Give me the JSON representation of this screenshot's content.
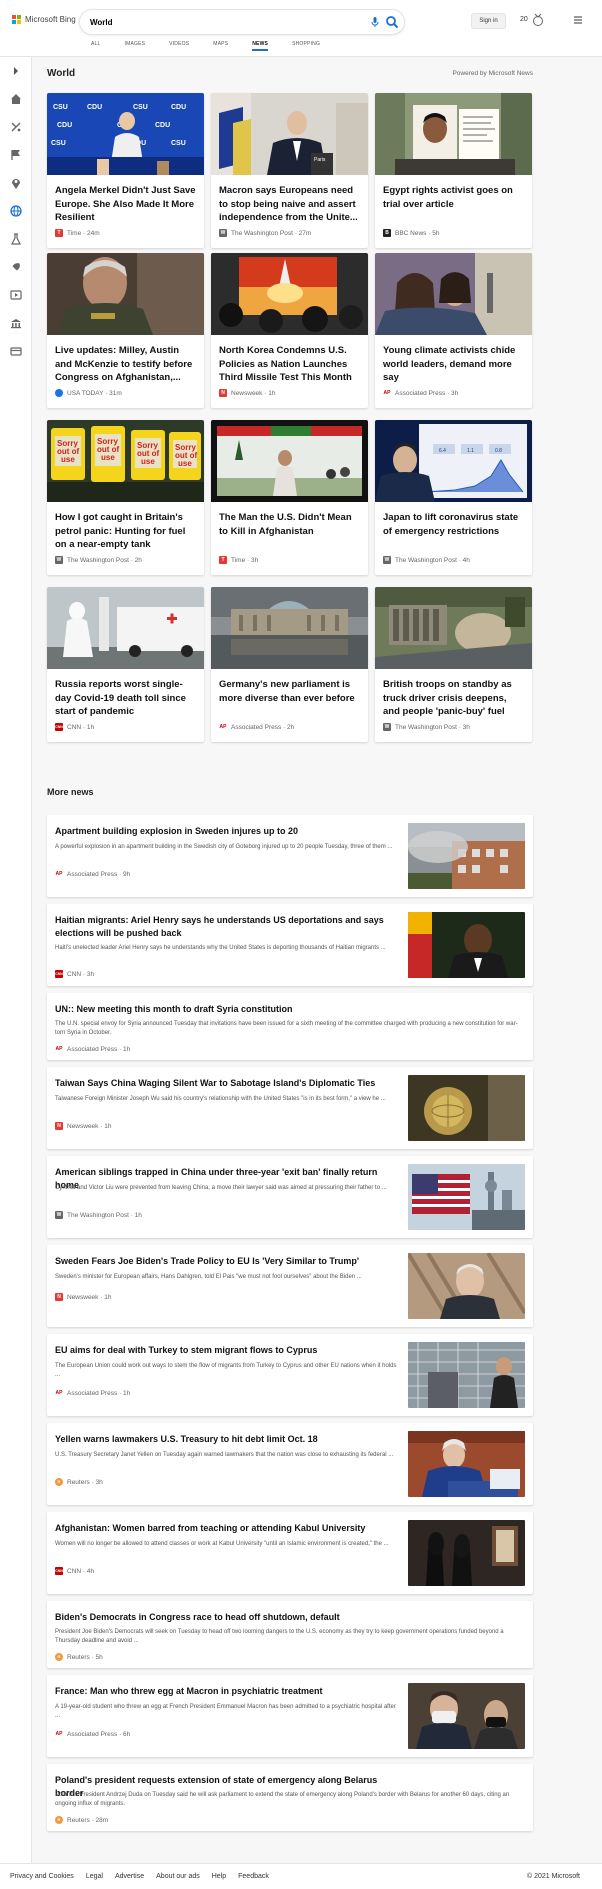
{
  "header": {
    "brand": "Microsoft Bing",
    "search_value": "World",
    "sign_in": "Sign in",
    "points": "20",
    "tabs": [
      {
        "label": "ALL"
      },
      {
        "label": "IMAGES"
      },
      {
        "label": "VIDEOS"
      },
      {
        "label": "MAPS"
      },
      {
        "label": "NEWS"
      },
      {
        "label": "SHOPPING"
      }
    ]
  },
  "rail": {
    "icons": [
      "expand-icon",
      "home-icon",
      "sports-icon",
      "flag-icon",
      "location-icon",
      "globe-icon",
      "science-icon",
      "rocket-icon",
      "entertainment-icon",
      "business-icon",
      "money-icon"
    ]
  },
  "section": {
    "title": "World",
    "powered_by": "Powered by Microsoft News"
  },
  "cards": [
    {
      "title": "Angela Merkel Didn't Just Save Europe. She Also Made It More Resilient",
      "source": "Time · 24m",
      "badge": "T",
      "badge_color": "#e53935"
    },
    {
      "title": "Macron says Europeans need to stop being naive and assert independence from the Unite...",
      "source": "The Washington Post · 27m",
      "badge": "W",
      "badge_color": "#666666"
    },
    {
      "title": "Egypt rights activist goes on trial over article",
      "source": "BBC News · 5h",
      "badge": "B",
      "badge_color": "#222222"
    },
    {
      "title": "Live updates: Milley, Austin and McKenzie to testify before Congress on Afghanistan,...",
      "source": "USA TODAY · 31m",
      "badge": "",
      "badge_color": "#1a73e8"
    },
    {
      "title": "North Korea Condemns U.S. Policies as Nation Launches Third Missile Test This Month",
      "source": "Newsweek · 1h",
      "badge": "N",
      "badge_color": "#e53935"
    },
    {
      "title": "Young climate activists chide world leaders, demand more say",
      "source": "Associated Press · 3h",
      "badge": "AP",
      "badge_color": "#ffffff"
    },
    {
      "title": "How I got caught in Britain's petrol panic: Hunting for fuel on a near-empty tank",
      "source": "The Washington Post · 2h",
      "badge": "W",
      "badge_color": "#666666"
    },
    {
      "title": "The Man the U.S. Didn't Mean to Kill in Afghanistan",
      "source": "Time · 3h",
      "badge": "T",
      "badge_color": "#e53935"
    },
    {
      "title": "Japan to lift coronavirus state of emergency restrictions",
      "source": "The Washington Post · 4h",
      "badge": "W",
      "badge_color": "#666666"
    },
    {
      "title": "Russia reports worst single-day Covid-19 death toll since start of pandemic",
      "source": "CNN · 1h",
      "badge": "CNN",
      "badge_color": "#cc0000"
    },
    {
      "title": "Germany's new parliament is more diverse than ever before",
      "source": "Associated Press · 2h",
      "badge": "AP",
      "badge_color": "#ffffff"
    },
    {
      "title": "British troops on standby as truck driver crisis deepens, and people 'panic-buy' fuel",
      "source": "The Washington Post · 3h",
      "badge": "W",
      "badge_color": "#666666"
    }
  ],
  "more_news": {
    "title": "More news",
    "items": [
      {
        "title": "Apartment building explosion in Sweden injures up to 20",
        "desc": "A powerful explosion in an apartment building in the Swedish city of Goteborg injured up to 20 people Tuesday, three of them ...",
        "source": "Associated Press · 9h",
        "badge": "AP"
      },
      {
        "title": "Haitian migrants: Ariel Henry says he understands US deportations and says elections will be pushed back",
        "desc": "Haiti's unelected leader Ariel Henry says he understands why the United States is deporting thousands of Haitian migrants ...",
        "source": "CNN · 3h",
        "badge": "CNN"
      },
      {
        "title": "UN:: New meeting this month to draft Syria constitution",
        "desc": "The U.N. special envoy for Syria announced Tuesday that invitations have been issued for a sixth meeting of the committee charged with producing a new constitution for war-torn Syria in October.",
        "source": "Associated Press · 1h",
        "badge": "AP"
      },
      {
        "title": "Taiwan Says China Waging Silent War to Sabotage Island's Diplomatic Ties",
        "desc": "Taiwanese Foreign Minister Joseph Wu said his country's relationship with the United States \"is in its best form,\" a view he ...",
        "source": "Newsweek · 1h",
        "badge": "N"
      },
      {
        "title": "American siblings trapped in China under three-year 'exit ban' finally return home",
        "desc": "Cynthia and Victor Liu were prevented from leaving China, a move their lawyer said was aimed at pressuring their father to ...",
        "source": "The Washington Post · 1h",
        "badge": "W"
      },
      {
        "title": "Sweden Fears Joe Biden's Trade Policy to EU Is 'Very Similar to Trump'",
        "desc": "Sweden's minister for European affairs, Hans Dahlgren, told El Pais \"we must not fool ourselves\" about the Biden ...",
        "source": "Newsweek · 1h",
        "badge": "N"
      },
      {
        "title": "EU aims for deal with Turkey to stem migrant flows to Cyprus",
        "desc": "The European Union could work out ways to stem the flow of migrants from Turkey to Cyprus and other EU nations when it holds ...",
        "source": "Associated Press · 1h",
        "badge": "AP"
      },
      {
        "title": "Yellen warns lawmakers U.S. Treasury to hit debt limit Oct. 18",
        "desc": "U.S. Treasury Secretary Janet Yellen on Tuesday again warned lawmakers that the nation was close to exhausting its federal ...",
        "source": "Reuters · 3h",
        "badge": "R"
      },
      {
        "title": "Afghanistan: Women barred from teaching or attending Kabul University",
        "desc": "Women will no longer be allowed to attend classes or work at Kabul University \"until an Islamic environment is created,\" the ...",
        "source": "CNN · 4h",
        "badge": "CNN"
      },
      {
        "title": "Biden's Democrats in Congress race to head off shutdown, default",
        "desc": "President Joe Biden's Democrats will seek on Tuesday to head off two looming dangers to the U.S. economy as they try to keep government operations funded beyond a Thursday deadline and avoid ...",
        "source": "Reuters · 5h",
        "badge": "R"
      },
      {
        "title": "France: Man who threw egg at Macron in psychiatric treatment",
        "desc": "A 19-year-old student who threw an egg at French President Emmanuel Macron has been admitted to a psychiatric hospital after ...",
        "source": "Associated Press · 6h",
        "badge": "AP"
      },
      {
        "title": "Poland's president requests extension of state of emergency along Belarus border",
        "desc": "Poland's President Andrzej Duda on Tuesday said he will ask parliament to extend the state of emergency along Poland's border with Belarus for another 60 days, citing an ongoing influx of migrants.",
        "source": "Reuters · 28m",
        "badge": "R"
      }
    ]
  },
  "footer": {
    "links": [
      "Privacy and Cookies",
      "Legal",
      "Advertise",
      "About our ads",
      "Help",
      "Feedback"
    ],
    "copyright": "© 2021 Microsoft"
  }
}
